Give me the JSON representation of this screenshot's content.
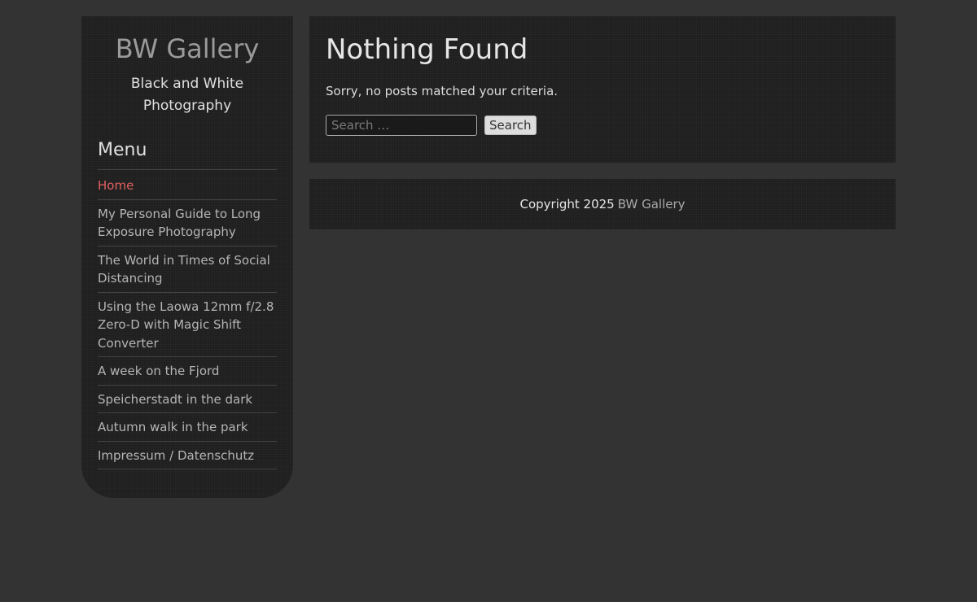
{
  "site": {
    "title": "BW Gallery",
    "description": "Black and White Photography"
  },
  "menu": {
    "title": "Menu",
    "items": [
      {
        "label": "Home",
        "active": true
      },
      {
        "label": "My Personal Guide to Long Exposure Photography"
      },
      {
        "label": "The World in Times of Social Distancing"
      },
      {
        "label": "Using the Laowa 12mm f/2.8 Zero-D with Magic Shift Converter"
      },
      {
        "label": "A week on the Fjord"
      },
      {
        "label": "Speicherstadt in the dark"
      },
      {
        "label": "Autumn walk in the park"
      },
      {
        "label": "Impressum / Datenschutz"
      }
    ]
  },
  "content": {
    "title": "Nothing Found",
    "message": "Sorry, no posts matched your criteria.",
    "search": {
      "placeholder": "Search …",
      "value": "",
      "button_label": "Search"
    }
  },
  "footer": {
    "copyright": "Copyright 2025",
    "link_label": "BW Gallery"
  },
  "colors": {
    "background": "#333333",
    "panel": "#1f1f1f",
    "active_link": "#e06060",
    "link": "#b5b5b5"
  }
}
